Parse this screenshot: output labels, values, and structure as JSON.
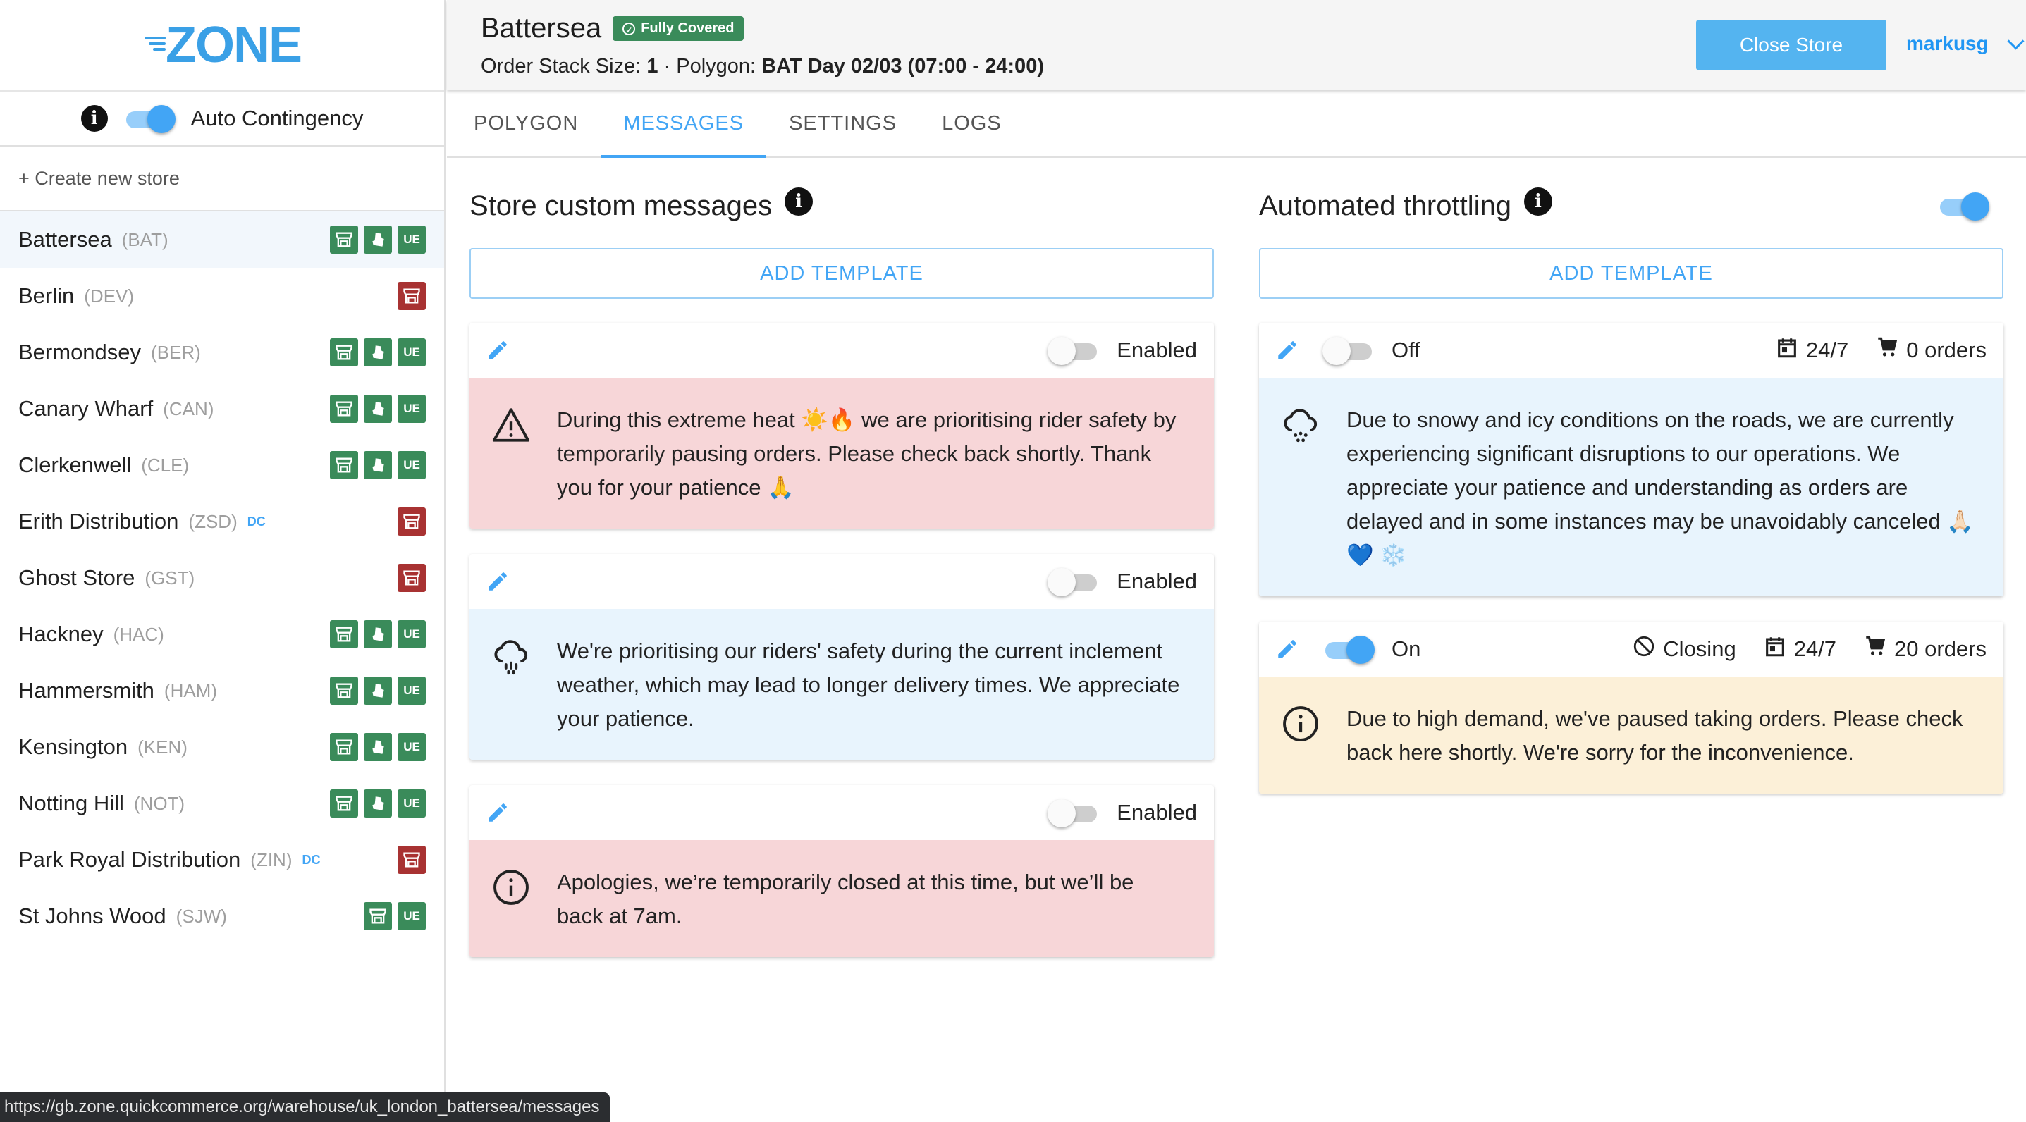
{
  "logo": "ZONE",
  "sidebar": {
    "auto_contingency_label": "Auto Contingency",
    "create_store_label": "+ Create new store",
    "stores": [
      {
        "name": "Battersea",
        "code": "(BAT)",
        "dc": "",
        "badges": [
          "store",
          "deliveroo",
          "UE"
        ]
      },
      {
        "name": "Berlin",
        "code": "(DEV)",
        "dc": "",
        "badges": [
          "store-red"
        ]
      },
      {
        "name": "Bermondsey",
        "code": "(BER)",
        "dc": "",
        "badges": [
          "store",
          "deliveroo",
          "UE"
        ]
      },
      {
        "name": "Canary Wharf",
        "code": "(CAN)",
        "dc": "",
        "badges": [
          "store",
          "deliveroo",
          "UE"
        ]
      },
      {
        "name": "Clerkenwell",
        "code": "(CLE)",
        "dc": "",
        "badges": [
          "store",
          "deliveroo",
          "UE"
        ]
      },
      {
        "name": "Erith Distribution",
        "code": "(ZSD)",
        "dc": "DC",
        "badges": [
          "store-red"
        ]
      },
      {
        "name": "Ghost Store",
        "code": "(GST)",
        "dc": "",
        "badges": [
          "store-red"
        ]
      },
      {
        "name": "Hackney",
        "code": "(HAC)",
        "dc": "",
        "badges": [
          "store",
          "deliveroo",
          "UE"
        ]
      },
      {
        "name": "Hammersmith",
        "code": "(HAM)",
        "dc": "",
        "badges": [
          "store",
          "deliveroo",
          "UE"
        ]
      },
      {
        "name": "Kensington",
        "code": "(KEN)",
        "dc": "",
        "badges": [
          "store",
          "deliveroo",
          "UE"
        ]
      },
      {
        "name": "Notting Hill",
        "code": "(NOT)",
        "dc": "",
        "badges": [
          "store",
          "deliveroo",
          "UE"
        ]
      },
      {
        "name": "Park Royal Distribution",
        "code": "(ZIN)",
        "dc": "DC",
        "badges": [
          "store-red"
        ]
      },
      {
        "name": "St Johns Wood",
        "code": "(SJW)",
        "dc": "",
        "badges": [
          "store",
          "UE"
        ]
      }
    ]
  },
  "status_url": "https://gb.zone.quickcommerce.org/warehouse/uk_london_battersea/messages",
  "header": {
    "store_title": "Battersea",
    "coverage_badge": "Fully Covered",
    "order_stack_label": "Order Stack Size:",
    "order_stack_value": "1",
    "polygon_label": "· Polygon:",
    "polygon_value": "BAT Day 02/03 (07:00 - 24:00)",
    "close_store_label": "Close Store",
    "username": "markusg"
  },
  "tabs": [
    {
      "label": "POLYGON",
      "active": false
    },
    {
      "label": "MESSAGES",
      "active": true
    },
    {
      "label": "SETTINGS",
      "active": false
    },
    {
      "label": "LOGS",
      "active": false
    }
  ],
  "custom_messages": {
    "title": "Store custom messages",
    "add_template_label": "ADD TEMPLATE",
    "cards": [
      {
        "toggle_label": "Enabled",
        "enabled": false,
        "color": "red",
        "icon": "warning-icon",
        "text": "During this extreme heat ☀️🔥 we are prioritising rider safety by temporarily pausing orders. Please check back shortly. Thank you for your patience 🙏"
      },
      {
        "toggle_label": "Enabled",
        "enabled": false,
        "color": "blue",
        "icon": "rain-cloud-icon",
        "text": "We're prioritising our riders' safety during the current inclement weather, which may lead to longer delivery times. We appreciate your patience."
      },
      {
        "toggle_label": "Enabled",
        "enabled": false,
        "color": "red",
        "icon": "info-circle-icon",
        "text": "Apologies, we’re temporarily closed at this time, but we’ll be back at 7am."
      }
    ]
  },
  "throttling": {
    "title": "Automated throttling",
    "enabled": true,
    "add_template_label": "ADD TEMPLATE",
    "cards": [
      {
        "toggle_label": "Off",
        "enabled": false,
        "closing_label": "",
        "schedule": "24/7",
        "orders": "0 orders",
        "color": "blue",
        "icon": "snow-cloud-icon",
        "text": "Due to snowy and icy conditions on the roads, we are currently experiencing significant disruptions to our operations. We appreciate your patience and understanding as orders are delayed and in some instances may be unavoidably canceled 🙏🏻 💙 ❄️"
      },
      {
        "toggle_label": "On",
        "enabled": true,
        "closing_label": "Closing",
        "schedule": "24/7",
        "orders": "20 orders",
        "color": "amber",
        "icon": "info-circle-icon",
        "text": "Due to high demand, we've paused taking orders. Please check back here shortly. We're sorry for the inconvenience."
      }
    ]
  },
  "colors": {
    "accent": "#42a5f5",
    "badge_green": "#3a8b5a",
    "badge_red": "#a83232",
    "red_card": "#f7d6d8",
    "blue_card": "#e8f4fd",
    "amber_card": "#fcf0d8"
  }
}
